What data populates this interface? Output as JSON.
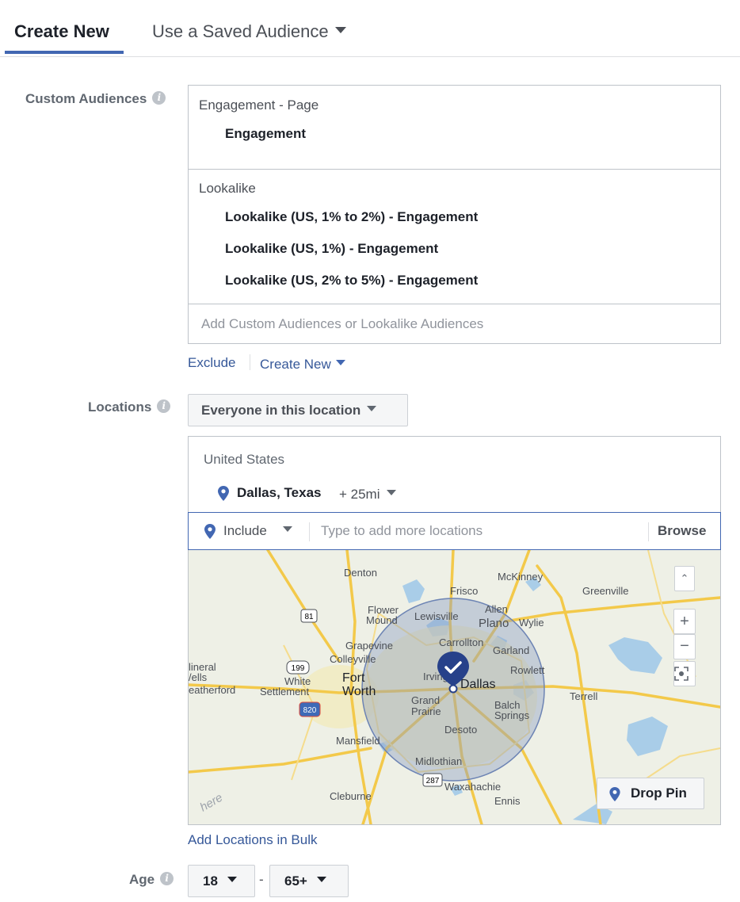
{
  "tabs": {
    "create_new": "Create New",
    "saved_audience": "Use a Saved Audience"
  },
  "custom_audiences": {
    "label": "Custom Audiences",
    "groups": [
      {
        "category": "Engagement - Page",
        "items": [
          "Engagement"
        ]
      },
      {
        "category": "Lookalike",
        "items": [
          "Lookalike (US, 1% to 2%) - Engagement",
          "Lookalike (US, 1%) - Engagement",
          "Lookalike (US, 2% to 5%) - Engagement"
        ]
      }
    ],
    "placeholder": "Add Custom Audiences or Lookalike Audiences",
    "exclude_label": "Exclude",
    "create_new_label": "Create New"
  },
  "locations": {
    "label": "Locations",
    "scope": "Everyone in this location",
    "country": "United States",
    "city": "Dallas, Texas",
    "radius": "+ 25mi",
    "include_label": "Include",
    "placeholder": "Type to add more locations",
    "browse_label": "Browse",
    "bulk_label": "Add Locations in Bulk",
    "drop_pin_label": "Drop Pin",
    "map": {
      "cities": {
        "denton": "Denton",
        "mckinney": "McKinney",
        "frisco": "Frisco",
        "greenville": "Greenville",
        "flower_mound_1": "Flower",
        "flower_mound_2": "Mound",
        "lewisville": "Lewisville",
        "allen": "Allen",
        "plano": "Plano",
        "wylie": "Wylie",
        "carrollton": "Carrollton",
        "grapevine": "Grapevine",
        "colleyville": "Colleyville",
        "garland": "Garland",
        "mineral_1": "lineral",
        "mineral_2": "/ells",
        "fort_1": "Fort",
        "fort_2": "Worth",
        "irving": "Irving",
        "dallas": "Dallas",
        "rowlett": "Rowlett",
        "white_1": "White",
        "white_2": "Settlement",
        "weatherford": "eatherford",
        "terrell": "Terrell",
        "grand_1": "Grand",
        "grand_2": "Prairie",
        "balch_1": "Balch",
        "balch_2": "Springs",
        "mansfield": "Mansfield",
        "desoto": "Desoto",
        "midlothian": "Midlothian",
        "cleburne": "Cleburne",
        "waxahachie": "Waxahachie",
        "ennis": "Ennis",
        "watermark": "here"
      },
      "highways": {
        "h81": "81",
        "h199": "199",
        "h820": "820",
        "h287": "287"
      }
    }
  },
  "age": {
    "label": "Age",
    "min": "18",
    "max": "65+"
  },
  "colors": {
    "accent": "#4267b2",
    "link": "#365899",
    "radius_fill": "#8b9dc3"
  }
}
